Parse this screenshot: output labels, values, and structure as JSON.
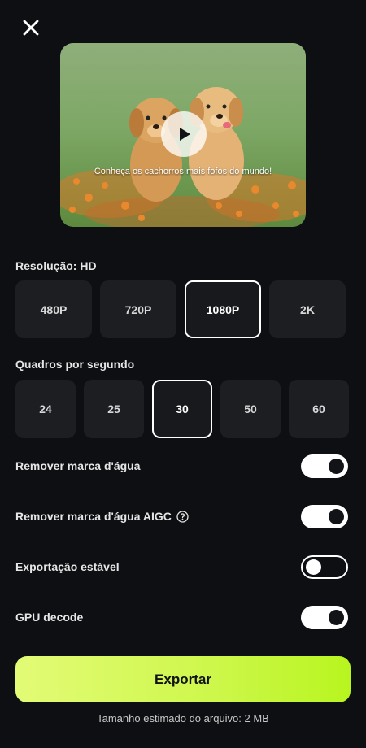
{
  "preview": {
    "caption": "Conheça os cachorros mais fofos do mundo!"
  },
  "resolution": {
    "label": "Resolução: HD",
    "options": [
      "480P",
      "720P",
      "1080P",
      "2K"
    ],
    "selected": "1080P"
  },
  "fps": {
    "label": "Quadros por segundo",
    "options": [
      "24",
      "25",
      "30",
      "50",
      "60"
    ],
    "selected": "30"
  },
  "toggles": [
    {
      "label": "Remover marca d'água",
      "on": true
    },
    {
      "label": "Remover marca d'água AIGC",
      "on": true,
      "has_help_icon": true
    },
    {
      "label": "Exportação estável",
      "on": false
    },
    {
      "label": "GPU decode",
      "on": true
    }
  ],
  "export": {
    "button_label": "Exportar",
    "size_note": "Tamanho estimado do arquivo: 2 MB"
  },
  "colors": {
    "background": "#0d0f12",
    "accent": "#cdf74a",
    "option_bg": "#1c1e22"
  },
  "icons": [
    "close-icon",
    "play-icon",
    "help-circle-icon"
  ]
}
